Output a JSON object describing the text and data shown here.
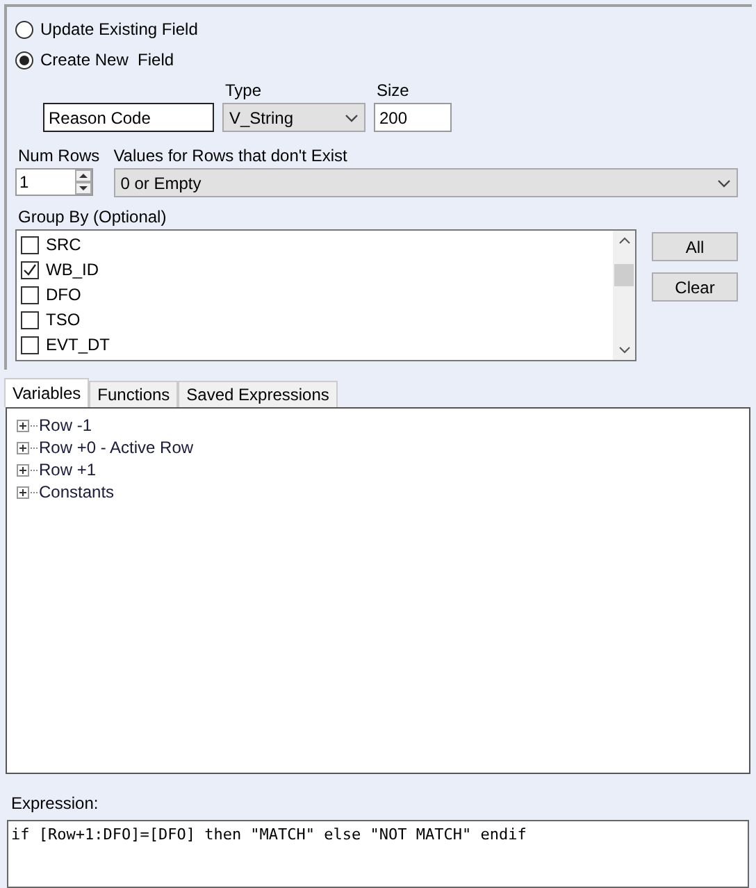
{
  "mode_options": [
    {
      "label": "Update Existing Field",
      "selected": false
    },
    {
      "label": "Create New  Field",
      "selected": true
    }
  ],
  "field": {
    "name": "Reason Code",
    "type_label": "Type",
    "type": "V_String",
    "size_label": "Size",
    "size": "200"
  },
  "num_rows": {
    "label": "Num Rows",
    "value": "1"
  },
  "missing_values": {
    "label": "Values for Rows that don't Exist",
    "value": "0 or Empty"
  },
  "group_by": {
    "label": "Group By (Optional)",
    "items": [
      {
        "label": "SRC",
        "checked": false
      },
      {
        "label": "WB_ID",
        "checked": true
      },
      {
        "label": "DFO",
        "checked": false
      },
      {
        "label": "TSO",
        "checked": false
      },
      {
        "label": "EVT_DT",
        "checked": false
      }
    ],
    "buttons": [
      "All",
      "Clear"
    ]
  },
  "tabs": [
    {
      "label": "Variables",
      "selected": true
    },
    {
      "label": "Functions",
      "selected": false
    },
    {
      "label": "Saved Expressions",
      "selected": false
    }
  ],
  "tree": [
    {
      "label": "Row -1",
      "expanded": false
    },
    {
      "label": "Row +0 - Active Row",
      "expanded": false
    },
    {
      "label": "Row +1",
      "expanded": false
    },
    {
      "label": "Constants",
      "expanded": false
    }
  ],
  "expression": {
    "label": "Expression:",
    "value": "if [Row+1:DFO]=[DFO] then \"MATCH\" else \"NOT MATCH\" endif"
  }
}
